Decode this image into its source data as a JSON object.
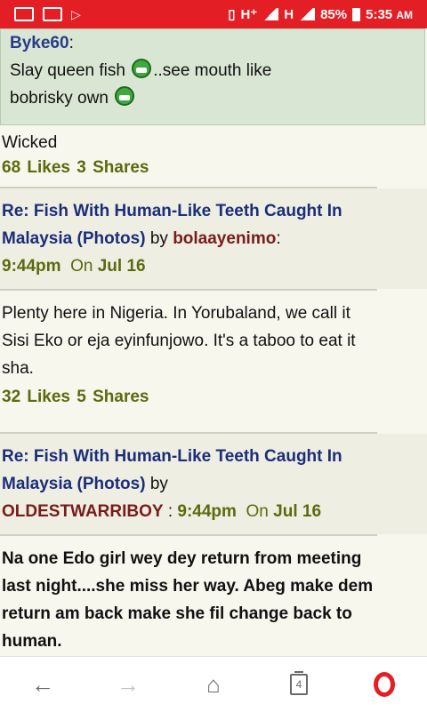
{
  "status_bar": {
    "network_1": "H⁺",
    "network_2": "H",
    "battery": "85%",
    "time": "5:35",
    "ampm": "AM"
  },
  "quote": {
    "author": "Byke60",
    "line1": "Slay queen fish",
    "line1_end": "..see mouth like",
    "line2": "bobrisky own"
  },
  "post1": {
    "text": "Wicked",
    "likes": "68 Likes",
    "shares": "3 Shares"
  },
  "post2": {
    "title": "Re: Fish With Human-Like Teeth Caught In Malaysia (Photos)",
    "by": "by",
    "user": "bolaayenimo",
    "time": "9:44pm",
    "on": "On",
    "date": "Jul 16",
    "text": "Plenty here in Nigeria. In Yorubaland, we call it Sisi Eko or eja eyinfunjowo. It's a taboo to eat it sha.",
    "likes": "32 Likes",
    "shares": "5 Shares"
  },
  "post3": {
    "title": "Re: Fish With Human-Like Teeth Caught In Malaysia (Photos)",
    "by": "by",
    "user": "OLDESTWARRIBOY",
    "time": "9:44pm",
    "on": "On",
    "date": "Jul 16",
    "text": "Na one Edo girl wey dey return from meeting last night....she  miss her way. Abeg make dem return am back make she fil change back  to human."
  },
  "navbar": {
    "tab_count": "4"
  },
  "colors": {
    "status_bar": "#e31e24",
    "link_blue": "#1b2e7a",
    "user_red": "#7a1b1b",
    "stat_olive": "#5c6a0c"
  }
}
